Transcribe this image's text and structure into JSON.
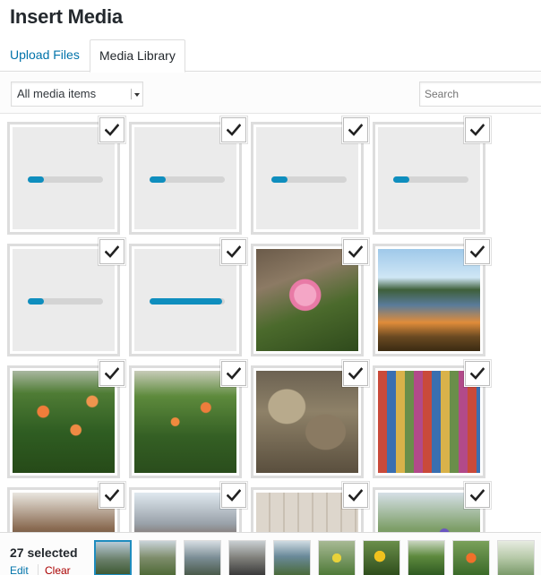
{
  "modal": {
    "title": "Insert Media"
  },
  "tabs": {
    "upload": "Upload Files",
    "library": "Media Library"
  },
  "toolbar": {
    "filter_value": "All media items",
    "search_placeholder": "Search"
  },
  "grid": {
    "items": [
      {
        "kind": "uploading",
        "progress": 0.22,
        "selected": true
      },
      {
        "kind": "uploading",
        "progress": 0.22,
        "selected": true
      },
      {
        "kind": "uploading",
        "progress": 0.22,
        "selected": true
      },
      {
        "kind": "uploading",
        "progress": 0.22,
        "selected": true
      },
      {
        "kind": "uploading",
        "progress": 0.22,
        "selected": true
      },
      {
        "kind": "uploading",
        "progress": 0.97,
        "selected": true
      },
      {
        "kind": "image",
        "subject": "pink-lily",
        "selected": true
      },
      {
        "kind": "image",
        "subject": "lake-lilies",
        "selected": true
      },
      {
        "kind": "image",
        "subject": "orange-daylilies",
        "selected": true
      },
      {
        "kind": "image",
        "subject": "daylilies-field",
        "selected": true
      },
      {
        "kind": "image",
        "subject": "yarn-skeins",
        "selected": true
      },
      {
        "kind": "image",
        "subject": "yarn-shelves",
        "selected": true
      },
      {
        "kind": "image",
        "subject": "shop-interior",
        "selected": true
      },
      {
        "kind": "image",
        "subject": "store-aisle",
        "selected": true
      },
      {
        "kind": "image",
        "subject": "wall-display",
        "selected": true
      },
      {
        "kind": "image",
        "subject": "iris-garden",
        "selected": true
      }
    ]
  },
  "footer": {
    "selected_count": "27 selected",
    "edit_label": "Edit",
    "clear_label": "Clear"
  },
  "icons": {
    "check": "checkmark-icon",
    "caret": "caret-down-icon"
  },
  "colors": {
    "accent": "#0073aa",
    "progress": "#0f8ebe",
    "clear": "#aa0000",
    "active_thumb_border": "#1e8cbe"
  }
}
